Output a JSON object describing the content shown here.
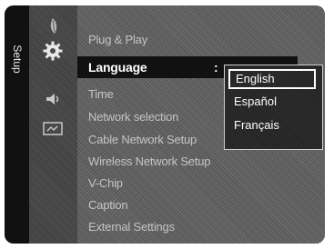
{
  "sidebar": {
    "label": "Setup"
  },
  "menu": {
    "items": [
      {
        "label": "Plug & Play",
        "selected": false
      },
      {
        "label": "Language",
        "selected": true,
        "separator": ":"
      },
      {
        "label": "Time",
        "selected": false
      },
      {
        "label": "Network selection",
        "selected": false
      },
      {
        "label": "Cable Network Setup",
        "selected": false
      },
      {
        "label": "Wireless Network Setup",
        "selected": false
      },
      {
        "label": "V-Chip",
        "selected": false
      },
      {
        "label": "Caption",
        "selected": false
      },
      {
        "label": "External Settings",
        "selected": false
      }
    ]
  },
  "language_dropdown": {
    "options": [
      "English",
      "Español",
      "Français"
    ],
    "highlighted": "English"
  },
  "category_icons": [
    "picture-icon",
    "setup-gear-icon",
    "sound-icon",
    "input-icon"
  ]
}
